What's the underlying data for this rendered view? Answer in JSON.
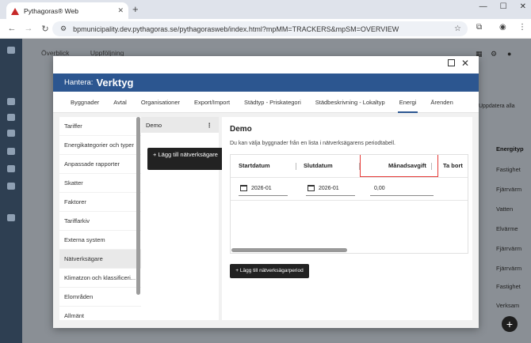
{
  "browser": {
    "tab_title": "Pythagoras® Web",
    "url": "bpmunicipality.dev.pythagoras.se/pythagorasweb/index.html?mpMM=TRACKERS&mpSM=OVERVIEW"
  },
  "app": {
    "tabs": [
      "Överblick",
      "Uppföljning"
    ],
    "update_all": "Uppdatera alla",
    "right_column_header": "Energityp",
    "right_column_values": [
      "Fastighet",
      "Fjärrvärm",
      "Vatten",
      "Elvärme",
      "Fjärrvärm",
      "Fjärrvärm",
      "Fastighet",
      "Verksam"
    ]
  },
  "modal": {
    "header_prefix": "Hantera:",
    "header_title": "Verktyg",
    "tabs": [
      {
        "label": "Byggnader",
        "active": false
      },
      {
        "label": "Avtal",
        "active": false
      },
      {
        "label": "Organisationer",
        "active": false
      },
      {
        "label": "Export/Import",
        "active": false
      },
      {
        "label": "Städtyp - Priskategori",
        "active": false
      },
      {
        "label": "Städbeskrivning - Lokaltyp",
        "active": false
      },
      {
        "label": "Energi",
        "active": true
      },
      {
        "label": "Ärenden",
        "active": false
      }
    ],
    "left_nav": [
      {
        "label": "Tariffer",
        "selected": false
      },
      {
        "label": "Energikategorier och typer",
        "selected": false
      },
      {
        "label": "Anpassade rapporter",
        "selected": false
      },
      {
        "label": "Skatter",
        "selected": false
      },
      {
        "label": "Faktorer",
        "selected": false
      },
      {
        "label": "Tariffarkiv",
        "selected": false
      },
      {
        "label": "Externa system",
        "selected": false
      },
      {
        "label": "Nätverksägare",
        "selected": true
      },
      {
        "label": "Klimatzon och klassificeri...",
        "selected": false
      },
      {
        "label": "Elområden",
        "selected": false
      },
      {
        "label": "Allmänt",
        "selected": false
      }
    ],
    "mid_panel": {
      "selected_item": "Demo",
      "more_icon": "⋮",
      "add_button": "+ Lägg till nätverksägare"
    },
    "content": {
      "title": "Demo",
      "description": "Du kan välja byggnader från en lista i nätverksägarens periodtabell.",
      "columns": [
        "Startdatum",
        "Slutdatum",
        "Månadsavgift",
        "Ta bort"
      ],
      "row": {
        "start": "2026-01",
        "end": "2026-01",
        "fee": "0,00"
      },
      "add_period_button": "+ Lägg till nätverksägarperiod"
    }
  }
}
